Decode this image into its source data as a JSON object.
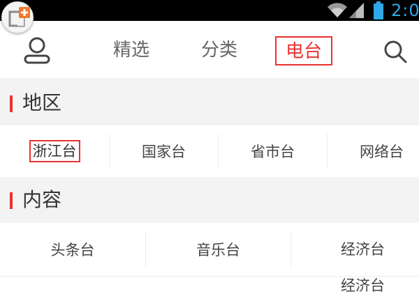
{
  "status_bar": {
    "time": "2:0",
    "icons": [
      "app-badge-icon",
      "wifi-icon",
      "signal-icon",
      "battery-icon"
    ],
    "time_color": "#2ea8e8"
  },
  "nav": {
    "user_icon": "user-icon",
    "tabs": [
      {
        "label": "精选",
        "selected": false
      },
      {
        "label": "分类",
        "selected": false
      },
      {
        "label": "电台",
        "selected": true
      }
    ],
    "search_icon": "search-icon",
    "accent": "#e8322f"
  },
  "sections": [
    {
      "title": "地区",
      "items": [
        {
          "label": "浙江台",
          "selected": true
        },
        {
          "label": "国家台",
          "selected": false
        },
        {
          "label": "省市台",
          "selected": false
        },
        {
          "label": "网络台",
          "selected": false
        }
      ]
    },
    {
      "title": "内容",
      "items": [
        {
          "label": "头条台",
          "selected": false
        },
        {
          "label": "音乐台",
          "selected": false
        },
        {
          "label": "经济台",
          "selected": false
        }
      ]
    }
  ],
  "drag_preview": {
    "label": "经济台"
  }
}
